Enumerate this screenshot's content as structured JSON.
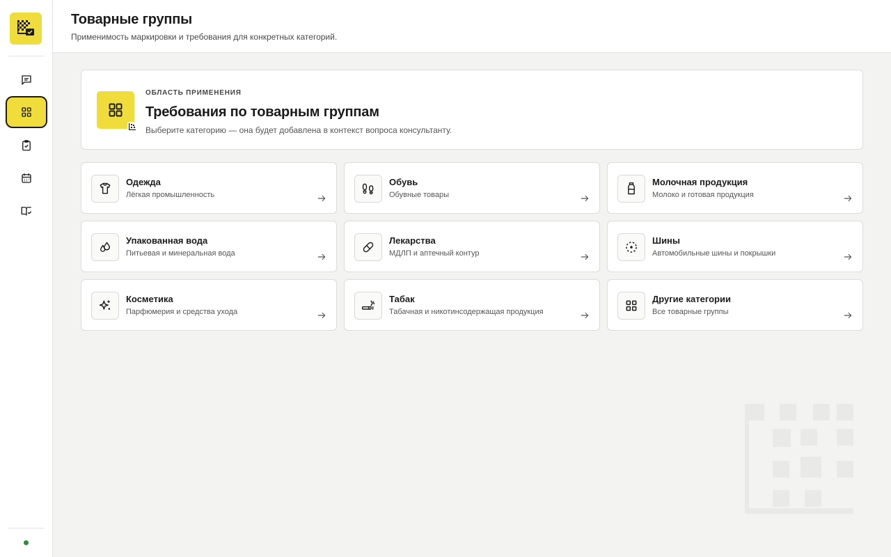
{
  "header": {
    "title": "Товарные группы",
    "subtitle": "Применимость маркировки и требования для конкретных категорий."
  },
  "sidebar": {
    "items": [
      {
        "icon": "message-icon",
        "active": false
      },
      {
        "icon": "grid-icon",
        "active": true
      },
      {
        "icon": "clipboard-check-icon",
        "active": false
      },
      {
        "icon": "calendar-icon",
        "active": false
      },
      {
        "icon": "book-check-icon",
        "active": false
      }
    ]
  },
  "hero": {
    "kicker": "ОБЛАСТЬ ПРИМЕНЕНИЯ",
    "title": "Требования по товарным группам",
    "subtitle": "Выберите категорию — она будет добавлена в контекст вопроса консультанту."
  },
  "categories": [
    {
      "title": "Одежда",
      "subtitle": "Лёгкая промышленность",
      "icon": "tshirt-icon"
    },
    {
      "title": "Обувь",
      "subtitle": "Обувные товары",
      "icon": "footprints-icon"
    },
    {
      "title": "Молочная продукция",
      "subtitle": "Молоко и готовая продукция",
      "icon": "milk-bottle-icon"
    },
    {
      "title": "Упакованная вода",
      "subtitle": "Питьевая и минеральная вода",
      "icon": "droplets-icon"
    },
    {
      "title": "Лекарства",
      "subtitle": "МДЛП и аптечный контур",
      "icon": "pill-icon"
    },
    {
      "title": "Шины",
      "subtitle": "Автомобильные шины и покрышки",
      "icon": "tire-icon"
    },
    {
      "title": "Косметика",
      "subtitle": "Парфюмерия и средства ухода",
      "icon": "sparkles-icon"
    },
    {
      "title": "Табак",
      "subtitle": "Табачная и никотинсодержащая продукция",
      "icon": "cigarette-icon"
    },
    {
      "title": "Другие категории",
      "subtitle": "Все товарные группы",
      "icon": "grid-icon"
    }
  ],
  "colors": {
    "accent": "#f0dd3c",
    "background": "#f3f3f2",
    "status": "#2e8b3a"
  }
}
